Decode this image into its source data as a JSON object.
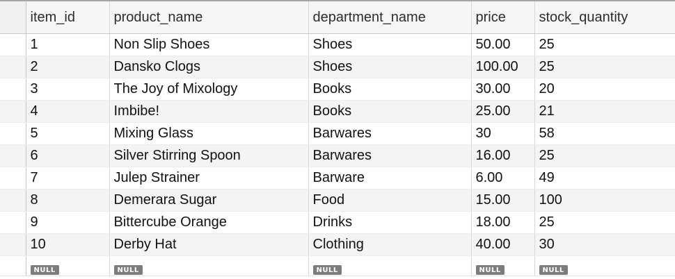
{
  "result_grid": {
    "columns": [
      "item_id",
      "product_name",
      "department_name",
      "price",
      "stock_quantity"
    ],
    "rows": [
      [
        "1",
        "Non Slip Shoes",
        "Shoes",
        "50.00",
        "25"
      ],
      [
        "2",
        "Dansko Clogs",
        "Shoes",
        "100.00",
        "25"
      ],
      [
        "3",
        "The Joy of Mixology",
        "Books",
        "30.00",
        "20"
      ],
      [
        "4",
        "Imbibe!",
        "Books",
        "25.00",
        "21"
      ],
      [
        "5",
        "Mixing Glass",
        "Barwares",
        "30",
        "58"
      ],
      [
        "6",
        "Silver Stirring Spoon",
        "Barwares",
        "16.00",
        "25"
      ],
      [
        "7",
        "Julep Strainer",
        "Barware",
        "6.00",
        "49"
      ],
      [
        "8",
        "Demerara Sugar",
        "Food",
        "15.00",
        "100"
      ],
      [
        "9",
        "Bittercube Orange",
        "Drinks",
        "18.00",
        "25"
      ],
      [
        "10",
        "Derby Hat",
        "Clothing",
        "40.00",
        "30"
      ]
    ],
    "new_row_placeholder": "NULL"
  }
}
